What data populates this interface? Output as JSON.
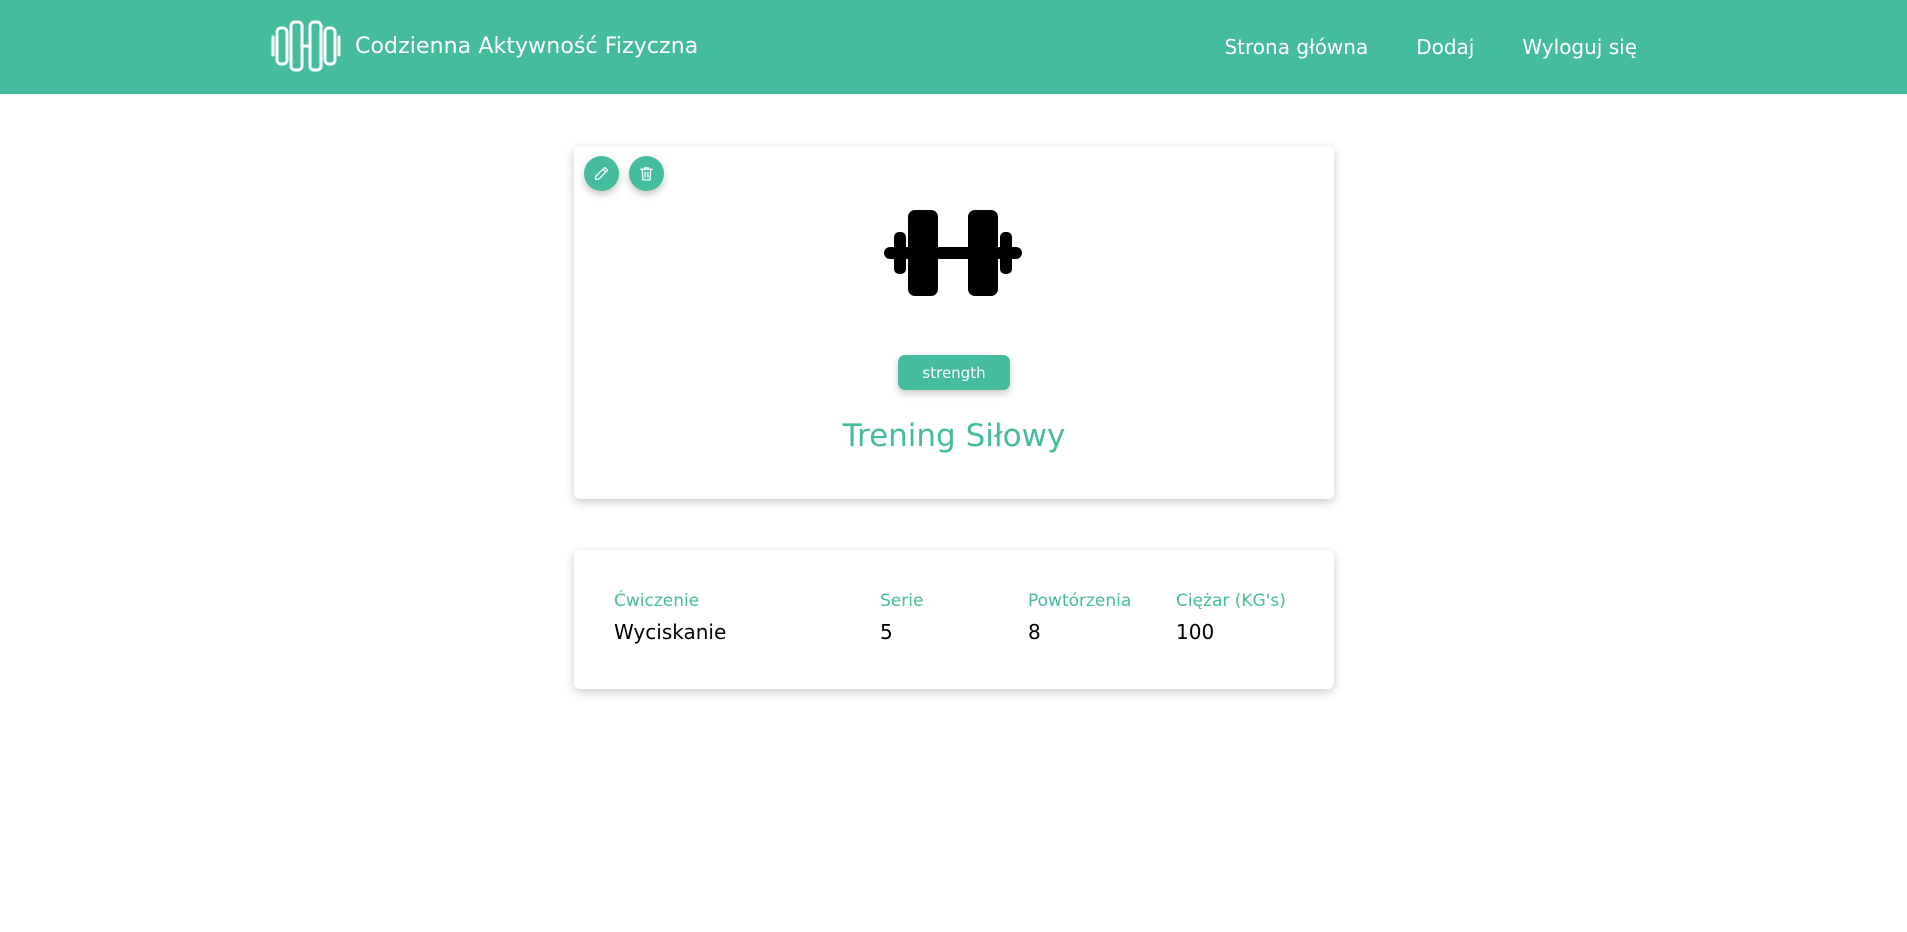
{
  "header": {
    "brand_title": "Codzienna Aktywność Fizyczna",
    "brand_icon": "dumbbell-outline-icon",
    "nav": [
      {
        "label": "Strona główna"
      },
      {
        "label": "Dodaj"
      },
      {
        "label": "Wyloguj się"
      }
    ]
  },
  "workout": {
    "edit_icon": "pencil-icon",
    "delete_icon": "trash-icon",
    "image_icon": "dumbbell-icon",
    "category_badge": "strength",
    "title": "Trening Siłowy"
  },
  "exercise_table": {
    "columns": [
      "Ćwiczenie",
      "Serie",
      "Powtórzenia",
      "Ciężar (KG's)"
    ],
    "rows": [
      [
        "Wyciskanie",
        "5",
        "8",
        "100"
      ]
    ]
  },
  "colors": {
    "accent": "#45bc9e",
    "text": "#000000",
    "background": "#ffffff"
  }
}
